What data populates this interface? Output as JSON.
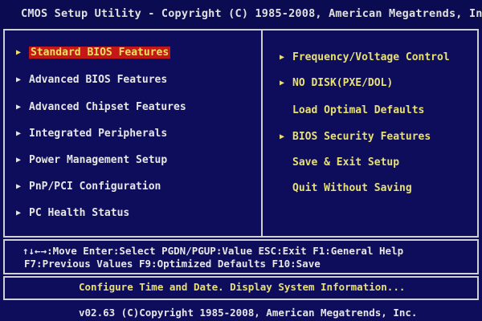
{
  "window": {
    "title": "CMOS Setup Utility - Copyright (C) 1985-2008, American Megatrends, In"
  },
  "left_menu": [
    {
      "label": "Standard BIOS Features",
      "selected": true
    },
    {
      "label": "Advanced BIOS Features"
    },
    {
      "label": "Advanced Chipset Features"
    },
    {
      "label": "Integrated Peripherals"
    },
    {
      "label": "Power Management Setup"
    },
    {
      "label": "PnP/PCI Configuration"
    },
    {
      "label": "PC Health Status"
    }
  ],
  "right_menu": [
    {
      "label": "Frequency/Voltage Control",
      "has_submenu": true
    },
    {
      "label": "NO DISK(PXE/DOL)",
      "has_submenu": true
    },
    {
      "label": "Load Optimal Defaults",
      "has_submenu": false
    },
    {
      "label": "BIOS Security Features",
      "has_submenu": true
    },
    {
      "label": "Save & Exit Setup",
      "has_submenu": false
    },
    {
      "label": "Quit Without Saving",
      "has_submenu": false
    }
  ],
  "help": {
    "line1": "↑↓←→:Move  Enter:Select  PGDN/PGUP:Value   ESC:Exit  F1:General Help",
    "line2": "F7:Previous Values F9:Optimized Defaults F10:Save"
  },
  "status": {
    "description": "Configure Time and Date.  Display System Information..."
  },
  "footer": {
    "version": "v02.63 (C)Copyright 1985-2008, American Megatrends, Inc."
  },
  "colors": {
    "background": "#0d0d5c",
    "selected_bg": "#c41818",
    "highlight_text": "#e8e070",
    "text": "#e6e6e6"
  },
  "icons": {
    "submenu": "triangle-right-icon"
  }
}
